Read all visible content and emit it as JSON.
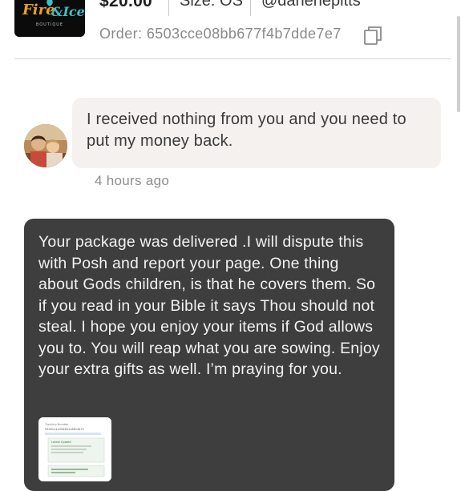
{
  "header": {
    "logo_text": "Fire&Ice",
    "logo_subtext": "BOUTIQUE",
    "price": "$20.00",
    "size": "Size: OS",
    "username": "@darlenepitts",
    "order": "Order: 6503cce08bb677f4b7dde7e7"
  },
  "messages": [
    {
      "sender": "other",
      "text": "I received nothing from you and you need to put my money back.",
      "timestamp": "4 hours ago"
    },
    {
      "sender": "self",
      "text": "Your package was delivered .I will dispute this with Posh and report your page. One thing about Gods children, is that he covers them. So if you read in your Bible it says Thou should not steal. I hope you enjoy your items if God allows you to. You will reap what you are sowing. Enjoy your extra gifts as well. I’m praying for you.",
      "attachment": {
        "tracking_label": "Tracking Number",
        "tracking_number": "9400111109460116814471",
        "status_label": "Latest Update"
      }
    }
  ],
  "colors": {
    "incoming_bubble": "#f4f1ef",
    "outgoing_bubble": "#3e3e3e",
    "logo_accent": "#e8a21c",
    "logo_teal": "#3fc0c8"
  }
}
